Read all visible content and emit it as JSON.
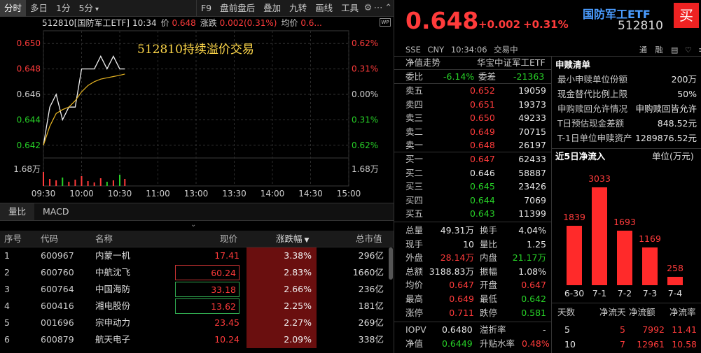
{
  "toolbar": {
    "tabs": [
      "分时",
      "多日",
      "1分",
      "5分"
    ],
    "five_arrow": "▾",
    "items": [
      "F9",
      "盘前盘后",
      "叠加",
      "九转",
      "画线",
      "工具"
    ],
    "icons": [
      "gear-icon",
      "more-icon",
      "up-icon"
    ]
  },
  "chart": {
    "code_name": "512810[国防军工ETF]",
    "time": "10:34",
    "price_label": "价",
    "price": "0.648",
    "change_label": "涨跌",
    "change": "0.002(0.31%)",
    "avg_label": "均价",
    "avg": "0.6...",
    "y_left": [
      "0.650",
      "0.648",
      "0.646",
      "0.644",
      "0.642"
    ],
    "y_right": [
      "0.62%",
      "0.31%",
      "0.00%",
      "0.31%",
      "0.62%"
    ],
    "vol_label": "1.68万",
    "x_labels": [
      "09:30",
      "10:00",
      "10:30",
      "11:00",
      "13:00",
      "13:30",
      "14:00",
      "14:30",
      "15:00"
    ],
    "annotation": "512810持续溢价交易",
    "wp_label": "WP"
  },
  "chart_data": {
    "type": "line",
    "x": [
      "09:30",
      "09:35",
      "09:40",
      "09:45",
      "09:50",
      "09:55",
      "10:00",
      "10:05",
      "10:10",
      "10:15",
      "10:20",
      "10:25",
      "10:30",
      "10:34"
    ],
    "series": [
      {
        "values": [
          0.642,
          0.645,
          0.646,
          0.644,
          0.645,
          0.645,
          0.648,
          0.648,
          0.648,
          0.649,
          0.648,
          0.649,
          0.648,
          0.648
        ]
      },
      {
        "values": [
          0.642,
          0.6435,
          0.6445,
          0.6448,
          0.645,
          0.6455,
          0.6462,
          0.6467,
          0.647,
          0.6472,
          0.6473,
          0.6474,
          0.6475,
          0.6476
        ]
      }
    ],
    "ylim": [
      0.641,
      0.651
    ],
    "grid": true
  },
  "subtabs": [
    "量比",
    "MACD"
  ],
  "list": {
    "headers": [
      "序号",
      "代码",
      "名称",
      "现价",
      "涨跌幅",
      "总市值"
    ],
    "sort_arrow": "▼",
    "rows": [
      {
        "idx": "1",
        "code": "600967",
        "name": "内蒙一机",
        "price": "17.41",
        "chg": "3.38%",
        "cap": "296亿"
      },
      {
        "idx": "2",
        "code": "600760",
        "name": "中航沈飞",
        "price": "60.24",
        "chg": "2.83%",
        "cap": "1660亿"
      },
      {
        "idx": "3",
        "code": "600764",
        "name": "中国海防",
        "price": "33.18",
        "chg": "2.66%",
        "cap": "236亿"
      },
      {
        "idx": "4",
        "code": "600416",
        "name": "湘电股份",
        "price": "13.62",
        "chg": "2.25%",
        "cap": "181亿"
      },
      {
        "idx": "5",
        "code": "001696",
        "name": "宗申动力",
        "price": "23.45",
        "chg": "2.27%",
        "cap": "269亿"
      },
      {
        "idx": "6",
        "code": "600879",
        "name": "航天电子",
        "price": "10.24",
        "chg": "2.09%",
        "cap": "338亿"
      }
    ]
  },
  "quote": {
    "price": "0.648",
    "change": "+0.002",
    "pct": "+0.31%",
    "name": "国防军工ETF",
    "code": "512810",
    "buy_btn": "买",
    "market": "SSE",
    "currency": "CNY",
    "time": "10:34:06",
    "status": "交易中",
    "top_icons": [
      "通",
      "融",
      "stock-icon",
      "heart-icon",
      "menu-icon"
    ],
    "nav_label": "净值走势",
    "index_name": "华宝中证军工ETF",
    "wb_label": "委比",
    "wb": "-6.14%",
    "wc_label": "委差",
    "wc": "-21363",
    "asks": [
      {
        "label": "卖五",
        "price": "0.652",
        "vol": "19059"
      },
      {
        "label": "卖四",
        "price": "0.651",
        "vol": "19373"
      },
      {
        "label": "卖三",
        "price": "0.650",
        "vol": "49233"
      },
      {
        "label": "卖二",
        "price": "0.649",
        "vol": "70715"
      },
      {
        "label": "卖一",
        "price": "0.648",
        "vol": "26197"
      }
    ],
    "bids": [
      {
        "label": "买一",
        "price": "0.647",
        "vol": "62433"
      },
      {
        "label": "买二",
        "price": "0.646",
        "vol": "58887"
      },
      {
        "label": "买三",
        "price": "0.645",
        "vol": "23426"
      },
      {
        "label": "买四",
        "price": "0.644",
        "vol": "7069"
      },
      {
        "label": "买五",
        "price": "0.643",
        "vol": "11399"
      }
    ],
    "stats": [
      {
        "l1": "总量",
        "v1": "49.31万",
        "c1": "w",
        "l2": "换手",
        "v2": "4.04%",
        "c2": "w"
      },
      {
        "l1": "现手",
        "v1": "10",
        "c1": "w",
        "l2": "量比",
        "v2": "1.25",
        "c2": "w"
      },
      {
        "l1": "外盘",
        "v1": "28.14万",
        "c1": "r",
        "l2": "内盘",
        "v2": "21.17万",
        "c2": "g"
      },
      {
        "l1": "总额",
        "v1": "3188.83万",
        "c1": "w",
        "l2": "振幅",
        "v2": "1.08%",
        "c2": "w"
      },
      {
        "l1": "均价",
        "v1": "0.647",
        "c1": "r",
        "l2": "开盘",
        "v2": "0.647",
        "c2": "r"
      },
      {
        "l1": "最高",
        "v1": "0.649",
        "c1": "r",
        "l2": "最低",
        "v2": "0.642",
        "c2": "g"
      },
      {
        "l1": "涨停",
        "v1": "0.711",
        "c1": "r",
        "l2": "跌停",
        "v2": "0.581",
        "c2": "g"
      }
    ],
    "iopv_label": "IOPV",
    "iopv": "0.6480",
    "premium_label": "溢折率",
    "premium": "-",
    "nav2_label": "净值",
    "nav2": "0.6449",
    "prem2_label": "升贴水率",
    "prem2": "0.48%"
  },
  "redeem": {
    "title": "申赎清单",
    "rows": [
      {
        "label": "最小申赎单位份额",
        "value": "200万"
      },
      {
        "label": "现金替代比例上限",
        "value": "50%"
      },
      {
        "label": "申购赎回允许情况",
        "value": "申购赎回皆允许"
      },
      {
        "label": "T日预估现金差额",
        "value": "848.52元"
      },
      {
        "label": "T-1日单位申赎资产",
        "value": "1289876.52元"
      }
    ]
  },
  "flow": {
    "title": "近5日净流入",
    "unit": "单位(万元)",
    "bars": [
      {
        "date": "6-30",
        "value": 1839
      },
      {
        "date": "7-1",
        "value": 3033
      },
      {
        "date": "7-2",
        "value": 1693
      },
      {
        "date": "7-3",
        "value": 1169
      },
      {
        "date": "7-4",
        "value": 258
      }
    ],
    "table_headers": [
      "天数",
      "净流天",
      "净流额",
      "净流率"
    ],
    "table_rows": [
      [
        "5",
        "5",
        "7992",
        "11.41"
      ],
      [
        "10",
        "7",
        "12961",
        "10.58"
      ]
    ]
  },
  "colors": {
    "up": "#ff3b3b",
    "down": "#27d027",
    "accent": "#e22222",
    "annotation": "#ffd84a"
  }
}
